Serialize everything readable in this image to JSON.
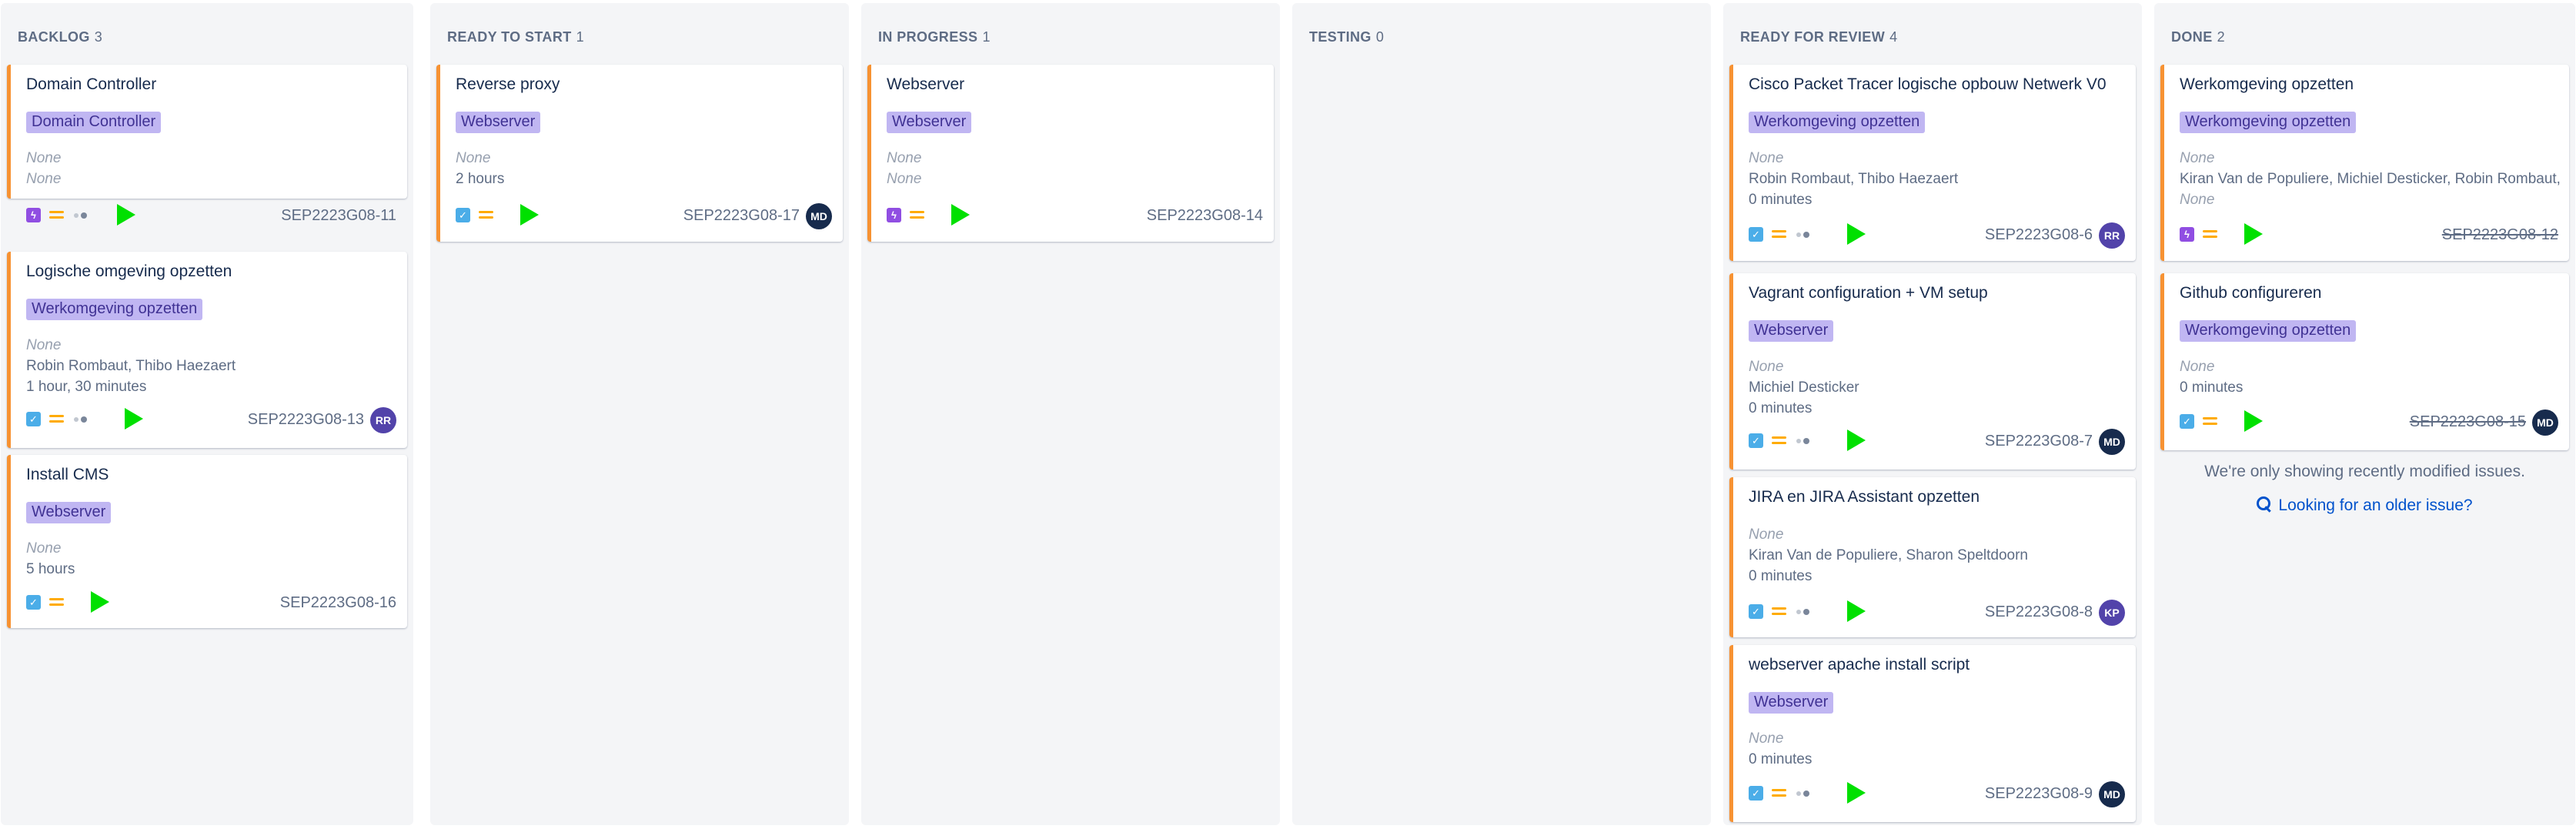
{
  "columns": [
    {
      "id": "backlog",
      "name": "BACKLOG",
      "count": "3",
      "cards": [
        {
          "title": "Domain Controller",
          "epic": "Domain Controller",
          "fields": [
            "None",
            "None"
          ],
          "type": "subtask",
          "key": "SEP2223G08-11",
          "avatar": ""
        },
        {
          "title": "Logische omgeving opzetten",
          "epic": "Werkomgeving opzetten",
          "fields": [
            "None",
            "Robin Rombaut, Thibo Haezaert",
            "1 hour, 30 minutes"
          ],
          "type": "task",
          "key": "SEP2223G08-13",
          "avatar": "RR"
        },
        {
          "title": "Install CMS",
          "epic": "Webserver",
          "fields": [
            "None",
            "5 hours"
          ],
          "type": "task",
          "key": "SEP2223G08-16",
          "avatar": ""
        }
      ]
    },
    {
      "id": "ready-to-start",
      "name": "READY TO START",
      "count": "1",
      "cards": [
        {
          "title": "Reverse proxy",
          "epic": "Webserver",
          "fields": [
            "None",
            "2 hours"
          ],
          "type": "task",
          "key": "SEP2223G08-17",
          "avatar": "MD"
        }
      ]
    },
    {
      "id": "in-progress",
      "name": "IN PROGRESS",
      "count": "1",
      "cards": [
        {
          "title": "Webserver",
          "epic": "Webserver",
          "fields": [
            "None",
            "None"
          ],
          "type": "subtask",
          "key": "SEP2223G08-14",
          "avatar": ""
        }
      ]
    },
    {
      "id": "testing",
      "name": "TESTING",
      "count": "0",
      "cards": []
    },
    {
      "id": "ready-for-review",
      "name": "READY FOR REVIEW",
      "count": "4",
      "cards": [
        {
          "title": "Cisco Packet Tracer logische opbouw Netwerk V0",
          "epic": "Werkomgeving opzetten",
          "fields": [
            "None",
            "Robin Rombaut, Thibo Haezaert",
            "0 minutes"
          ],
          "type": "task",
          "key": "SEP2223G08-6",
          "avatar": "RR"
        },
        {
          "title": "Vagrant configuration + VM setup",
          "epic": "Webserver",
          "fields": [
            "None",
            "Michiel Desticker",
            "0 minutes"
          ],
          "type": "task",
          "key": "SEP2223G08-7",
          "avatar": "MD"
        },
        {
          "title": "JIRA en JIRA Assistant opzetten",
          "epic": "",
          "fields": [
            "None",
            "Kiran Van de Populiere, Sharon Speltdoorn",
            "0 minutes"
          ],
          "type": "task",
          "key": "SEP2223G08-8",
          "avatar": "KP"
        },
        {
          "title": "webserver apache install script",
          "epic": "Webserver",
          "fields": [
            "None",
            "0 minutes"
          ],
          "type": "task",
          "key": "SEP2223G08-9",
          "avatar": "MD"
        }
      ]
    },
    {
      "id": "done",
      "name": "DONE",
      "count": "2",
      "cards": [
        {
          "title": "Werkomgeving opzetten",
          "epic": "Werkomgeving opzetten",
          "fields": [
            "None",
            "Kiran Van de Populiere, Michiel Desticker, Robin Rombaut,",
            "None"
          ],
          "type": "subtask",
          "key": "SEP2223G08-12",
          "avatar": ""
        },
        {
          "title": "Github configureren",
          "epic": "Werkomgeving opzetten",
          "fields": [
            "None",
            "0 minutes"
          ],
          "type": "task",
          "key": "SEP2223G08-15",
          "avatar": "MD"
        }
      ],
      "notice": "We're only showing recently modified issues.",
      "older_link": "Looking for an older issue?"
    }
  ],
  "colors": {
    "column_bg": "#f4f5f7",
    "card_accent": "#f79232",
    "epic_bg": "#c0b6f2",
    "epic_text": "#403294",
    "play": "#00e000",
    "link": "#0052cc"
  },
  "icons": {
    "task": "checkbox-task-icon",
    "subtask": "lightning-subtask-icon",
    "priority": "medium-priority-icon",
    "estimate": "estimate-dots-icon",
    "play": "play-timer-icon",
    "search": "search-icon"
  }
}
